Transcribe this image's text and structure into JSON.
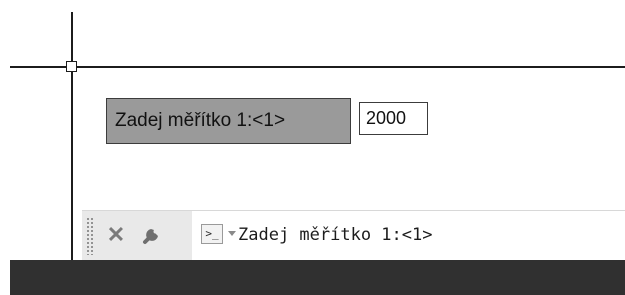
{
  "dynamic_input": {
    "prompt": "Zadej měřítko 1:<1>",
    "value": "2000"
  },
  "command_line": {
    "close_glyph": "✕",
    "customize_icon": "wrench-icon",
    "prompt_icon": "command-prompt-icon",
    "prompt_glyph": ">_",
    "text": "Zadej měřítko 1:<1>"
  },
  "colors": {
    "prompt_background": "#9a9a9a",
    "canvas_background": "#ffffff",
    "status_bar": "#303030",
    "crosshair": "#1c1c1c"
  }
}
